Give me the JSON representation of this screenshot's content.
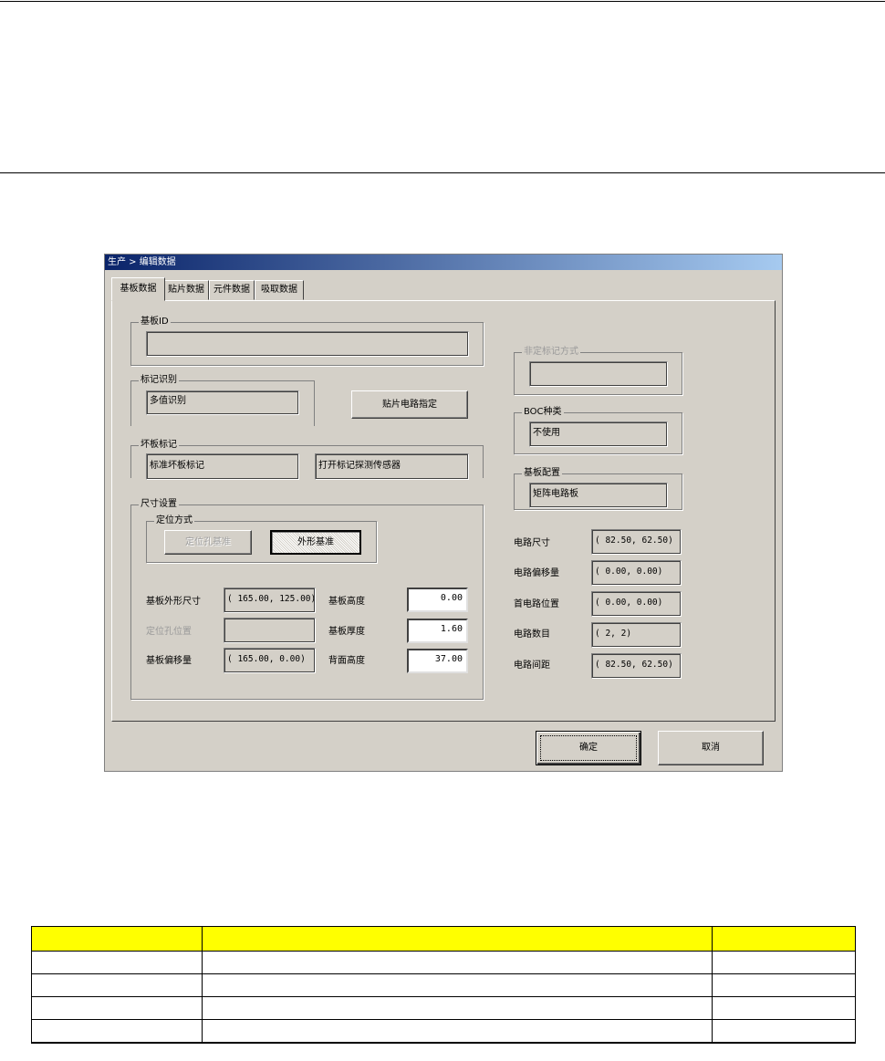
{
  "window": {
    "title": "生产 > 编辑数据"
  },
  "tabs": [
    {
      "label": "基板数据",
      "active": true
    },
    {
      "label": "贴片数据",
      "active": false
    },
    {
      "label": "元件数据",
      "active": false
    },
    {
      "label": "吸取数据",
      "active": false
    }
  ],
  "board_id": {
    "label": "基板ID",
    "value": ""
  },
  "mark_recognition": {
    "label": "标记识别",
    "value": "多值识别",
    "circuit_button": "贴片电路指定"
  },
  "bad_mark": {
    "label": "坏板标记",
    "value": "标准坏板标记",
    "sensor": "打开标记探测传感器"
  },
  "size_setting": {
    "label": "尺寸设置",
    "positioning": {
      "label": "定位方式",
      "hole_button": "定位孔基准",
      "outline_button": "外形基准",
      "selected": "外形基准"
    },
    "outline_size": {
      "label": "基板外形尺寸",
      "value": "( 165.00, 125.00)"
    },
    "hole_position": {
      "label": "定位孔位置",
      "value": ""
    },
    "offset": {
      "label": "基板偏移量",
      "value": "( 165.00,   0.00)"
    },
    "board_height": {
      "label": "基板高度",
      "value": "0.00"
    },
    "board_thickness": {
      "label": "基板厚度",
      "value": "1.60"
    },
    "back_height": {
      "label": "背面高度",
      "value": "37.00"
    }
  },
  "fixed_mark_method": {
    "label": "非定标记方式",
    "value": ""
  },
  "boc_type": {
    "label": "BOC种类",
    "value": "不使用"
  },
  "board_config": {
    "label": "基板配置",
    "value": "矩阵电路板"
  },
  "circuit": [
    {
      "label": "电路尺寸",
      "value": "(  82.50,  62.50)"
    },
    {
      "label": "电路偏移量",
      "value": "(   0.00,   0.00)"
    },
    {
      "label": "首电路位置",
      "value": "(   0.00,   0.00)"
    },
    {
      "label": "电路数目",
      "value": "(      2,      2)"
    },
    {
      "label": "电路间距",
      "value": "(  82.50,  62.50)"
    }
  ],
  "buttons": {
    "ok": "确定",
    "cancel": "取消"
  },
  "table": {
    "header_color": "#ffff00",
    "rows": [
      [
        "",
        "",
        ""
      ],
      [
        "",
        "",
        ""
      ],
      [
        "",
        "",
        ""
      ],
      [
        "",
        "",
        ""
      ],
      [
        "",
        "",
        ""
      ]
    ]
  }
}
